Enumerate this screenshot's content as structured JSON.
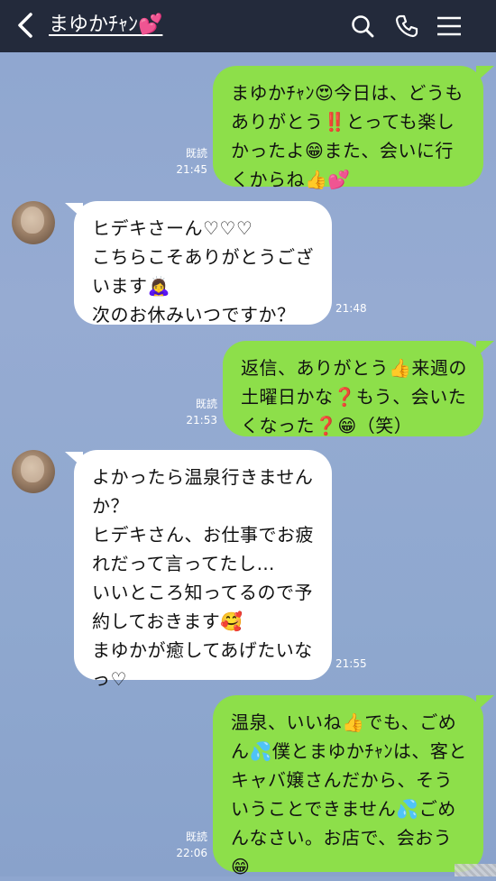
{
  "header": {
    "back_icon": "chevron-left-icon",
    "title": "まゆかﾁｬﾝ💕",
    "search_icon": "search-icon",
    "call_icon": "phone-icon",
    "menu_icon": "hamburger-menu-icon"
  },
  "colors": {
    "header_bg": "#232a3b",
    "chat_bg": "#8ea6cf",
    "outgoing_bubble": "#8ddf4a",
    "incoming_bubble": "#ffffff"
  },
  "messages": [
    {
      "direction": "out",
      "text": "まゆかﾁｬﾝ😍今日は、どうも\nありがとう‼️とっても楽し\nかったよ😁また、会いに行\nくからね👍💕",
      "read": "既読",
      "time": "21:45"
    },
    {
      "direction": "in",
      "text": "ヒデキさーん♡♡♡\nこちらこそありがとうござ\nいます🙇‍♀️\n次のお休みいつですか？",
      "time": "21:48"
    },
    {
      "direction": "out",
      "text": "返信、ありがとう👍来週の\n土曜日かな❓もう、会いた\nくなった❓😁（笑）",
      "read": "既読",
      "time": "21:53"
    },
    {
      "direction": "in",
      "text": "よかったら温泉行きません\nか？\nヒデキさん、お仕事でお疲\nれだって言ってたし…\nいいところ知ってるので予\n約しておきます🥰\nまゆかが癒してあげたいなっ♡",
      "time": "21:55"
    },
    {
      "direction": "out",
      "text": "温泉、いいね👍でも、ごめ\nん💦僕とまゆかﾁｬﾝは、客と\nキャバ嬢さんだから、そう\nいうことできません💦ごめ\nんなさい。お店で、会おう\n😁",
      "read": "既読",
      "time": "22:06"
    }
  ]
}
